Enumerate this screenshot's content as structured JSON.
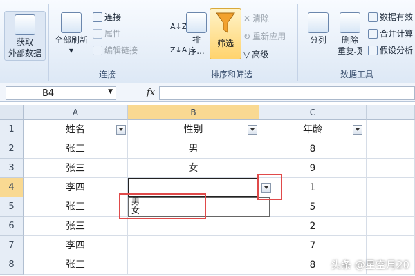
{
  "ribbon": {
    "get_external": {
      "line1": "获取",
      "line2": "外部数据"
    },
    "refresh_all": "全部刷新",
    "connections": "连接",
    "properties": "属性",
    "edit_links": "编辑链接",
    "group_connections": "连接",
    "sort": "排序...",
    "filter": "筛选",
    "clear": "清除",
    "reapply": "重新应用",
    "advanced": "高级",
    "group_sort_filter": "排序和筛选",
    "text_to_columns": "分列",
    "remove_duplicates": {
      "line1": "删除",
      "line2": "重复项"
    },
    "data_validation": "数据有效",
    "consolidate": "合并计算",
    "what_if": "假设分析",
    "group_data_tools": "数据工具"
  },
  "formula_bar": {
    "name_box": "B4",
    "fx": "fx"
  },
  "columns": [
    "A",
    "B",
    "C"
  ],
  "rows": [
    {
      "num": "1",
      "a": "姓名",
      "b": "性别",
      "c": "年龄"
    },
    {
      "num": "2",
      "a": "张三",
      "b": "男",
      "c": "8"
    },
    {
      "num": "3",
      "a": "张三",
      "b": "女",
      "c": "9"
    },
    {
      "num": "4",
      "a": "李四",
      "b": "",
      "c": "1"
    },
    {
      "num": "5",
      "a": "张三",
      "b": "",
      "c": "5"
    },
    {
      "num": "6",
      "a": "张三",
      "b": "",
      "c": "2"
    },
    {
      "num": "7",
      "a": "李四",
      "b": "",
      "c": "7"
    },
    {
      "num": "8",
      "a": "张三",
      "b": "",
      "c": "8"
    }
  ],
  "dropdown_list": [
    "男",
    "女"
  ],
  "watermark": "头条 @星空月20",
  "colors": {
    "highlight": "#e04a4a",
    "selected_header": "#f9d992"
  }
}
